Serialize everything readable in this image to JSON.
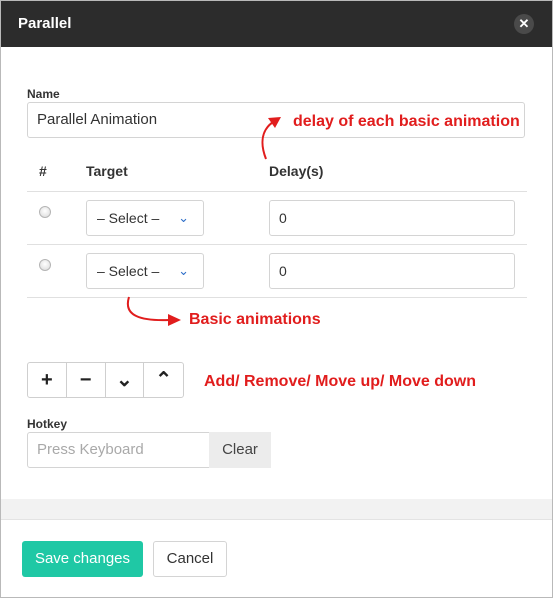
{
  "dialog": {
    "title": "Parallel",
    "close_glyph": "✕"
  },
  "name_field": {
    "label": "Name",
    "value": "Parallel Animation"
  },
  "table": {
    "headers": {
      "index": "#",
      "target": "Target",
      "delay": "Delay(s)"
    },
    "rows": [
      {
        "target": "– Select –",
        "delay": "0"
      },
      {
        "target": "– Select –",
        "delay": "0"
      }
    ],
    "chevron_glyph": "⌄"
  },
  "toolbar": {
    "add": "+",
    "remove": "−",
    "down": "⌄",
    "up": "⌃"
  },
  "hotkey": {
    "label": "Hotkey",
    "placeholder": "Press Keyboard",
    "clear_label": "Clear"
  },
  "footer": {
    "save_label": "Save changes",
    "cancel_label": "Cancel"
  },
  "annotations": {
    "delay_note": "delay of each basic animation",
    "basic_note": "Basic animations",
    "toolbar_note": "Add/ Remove/ Move up/ Move down",
    "color": "#e11d1d"
  },
  "colors": {
    "primary": "#1fc8a5",
    "titlebar": "#2c2c2c",
    "chevron": "#2f6fc9"
  }
}
